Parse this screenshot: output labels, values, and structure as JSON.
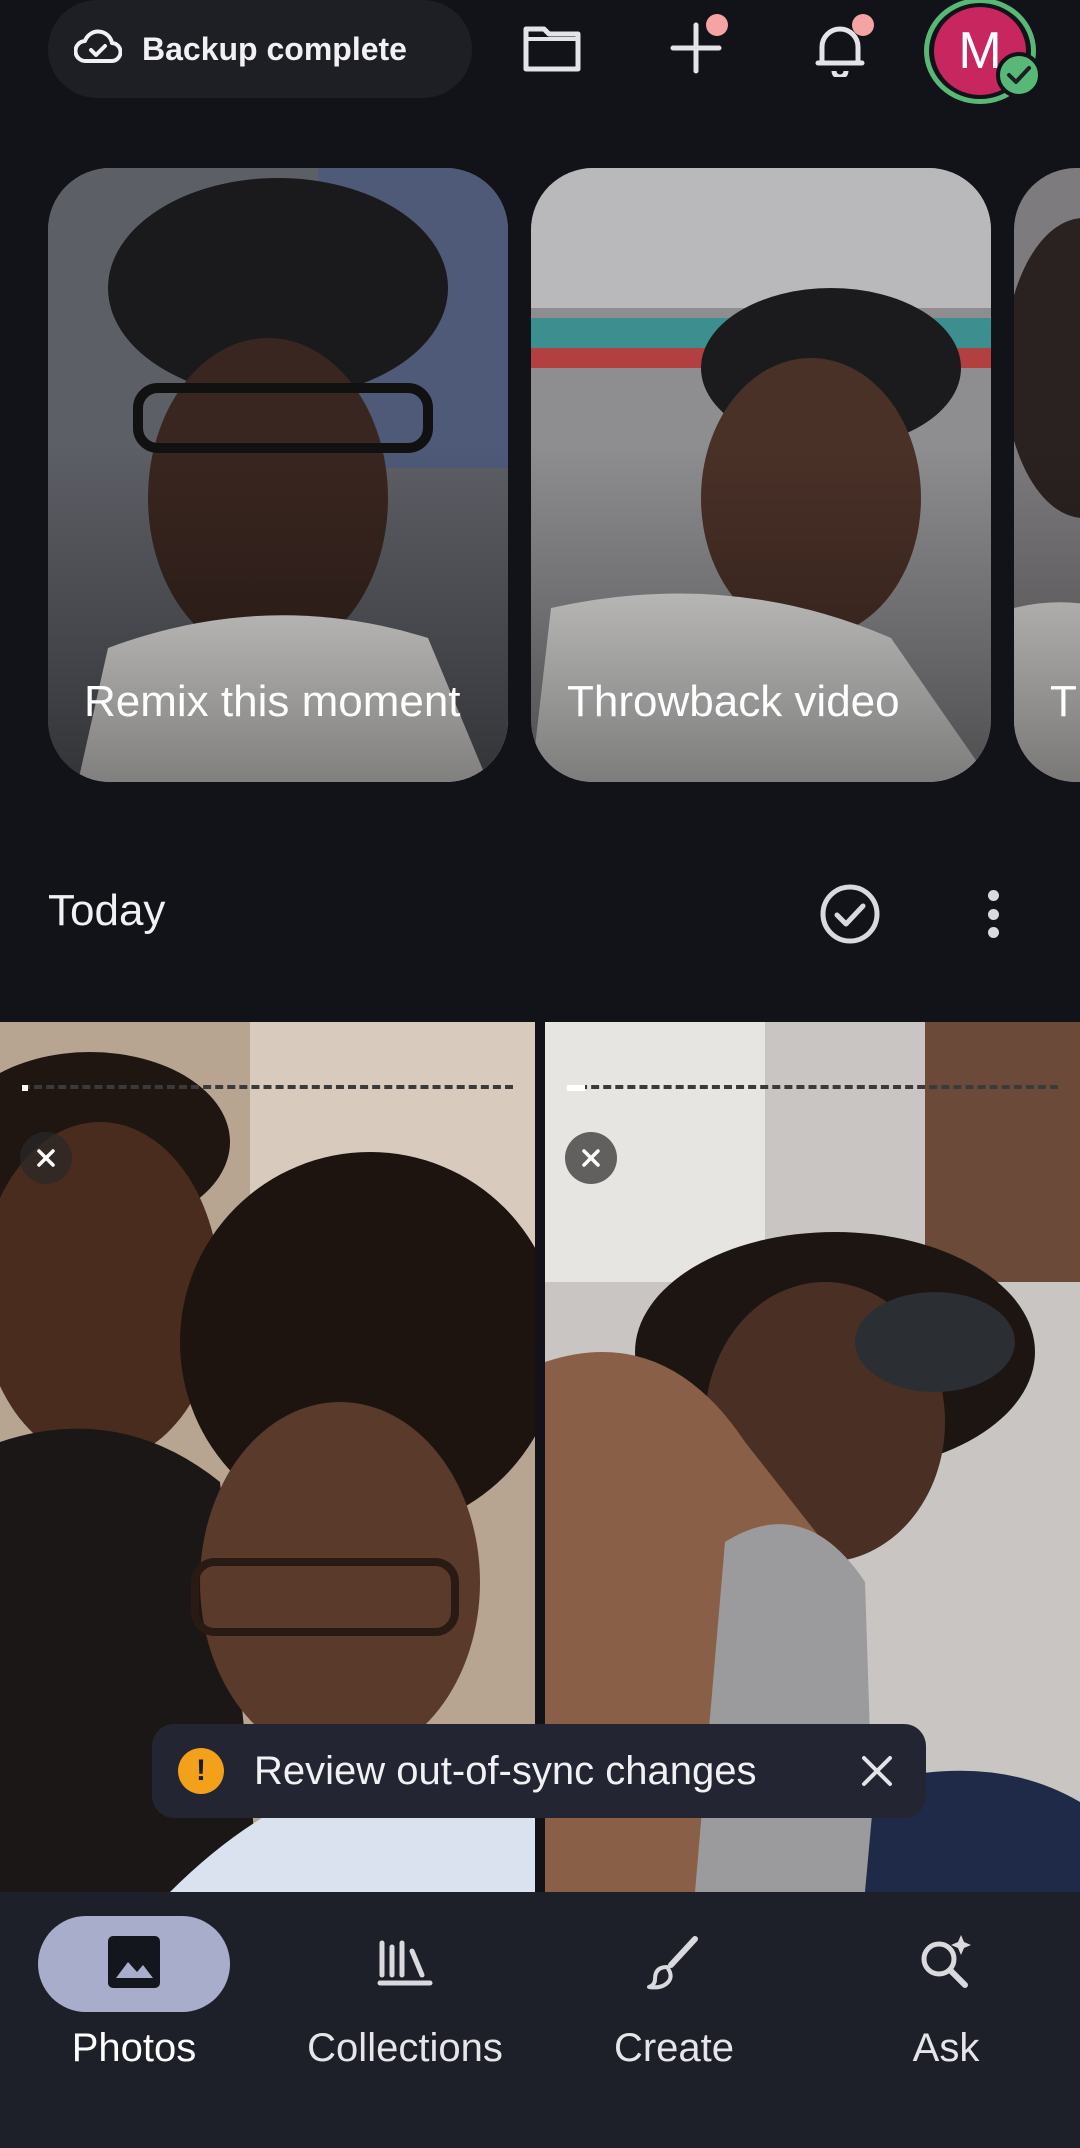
{
  "header": {
    "backup_label": "Backup complete",
    "avatar_initial": "M"
  },
  "memories": [
    {
      "title": "Remix this moment"
    },
    {
      "title": "Throwback video"
    },
    {
      "title": "T vi"
    }
  ],
  "section": {
    "title": "Today"
  },
  "snackbar": {
    "icon_text": "!",
    "message": "Review out-of-sync changes"
  },
  "bottom_nav": {
    "items": [
      {
        "label": "Photos",
        "icon": "photo-icon",
        "active": true
      },
      {
        "label": "Collections",
        "icon": "collections-icon",
        "active": false
      },
      {
        "label": "Create",
        "icon": "brush-icon",
        "active": false
      },
      {
        "label": "Ask",
        "icon": "ask-search-icon",
        "active": false
      }
    ]
  },
  "colors": {
    "background": "#121318",
    "avatar": "#c7265f",
    "backup_ok": "#58b878",
    "warning": "#f3a11a",
    "nav_active_pill": "#a8adcc"
  }
}
